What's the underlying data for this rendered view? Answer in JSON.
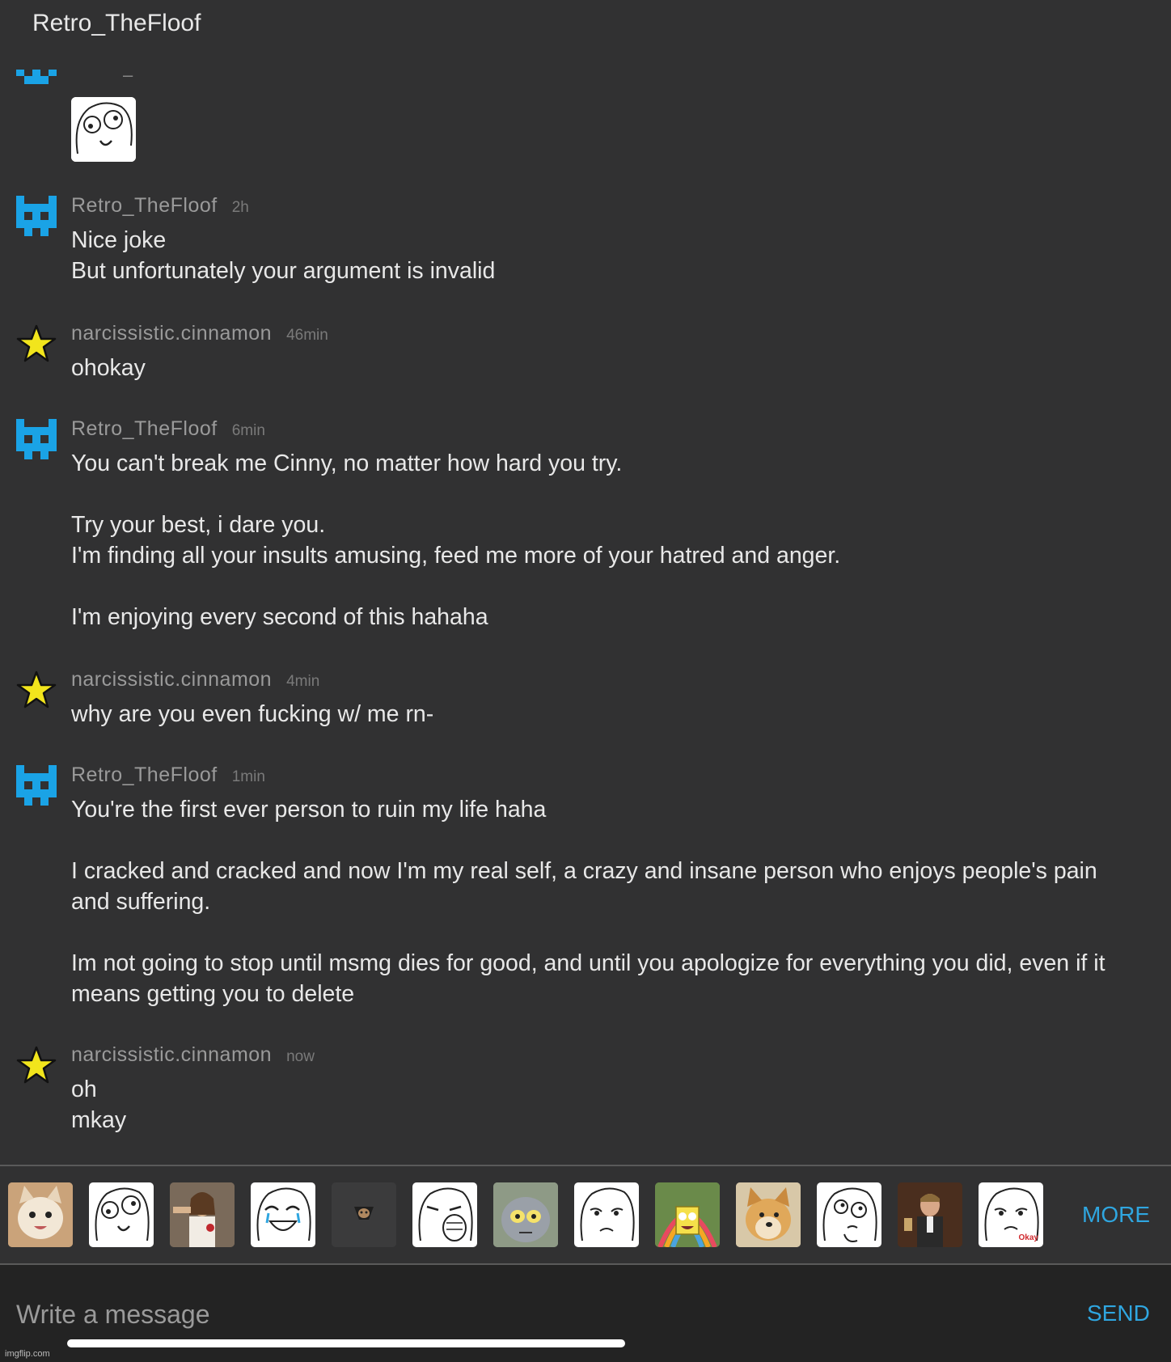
{
  "header": {
    "title": "Retro_TheFloof"
  },
  "top_partial": {
    "dash": "–"
  },
  "messages": [
    {
      "user": "Retro_TheFloof",
      "time": "2h",
      "avatar": "pixel-cat-icon",
      "lines": [
        "Nice joke",
        "But unfortunately your argument is invalid"
      ]
    },
    {
      "user": "narcissistic.cinnamon",
      "time": "46min",
      "avatar": "star-icon",
      "lines": [
        "ohokay"
      ]
    },
    {
      "user": "Retro_TheFloof",
      "time": "6min",
      "avatar": "pixel-cat-icon",
      "lines": [
        "You can't break me Cinny, no matter how hard you try.",
        "",
        "Try your best, i dare you.",
        "I'm finding all your insults amusing, feed me more of your hatred and anger.",
        "",
        "I'm enjoying every second of this hahaha"
      ]
    },
    {
      "user": "narcissistic.cinnamon",
      "time": "4min",
      "avatar": "star-icon",
      "lines": [
        "why are you even fucking w/ me rn-"
      ]
    },
    {
      "user": "Retro_TheFloof",
      "time": "1min",
      "avatar": "pixel-cat-icon",
      "lines": [
        "You're the first ever person to ruin my life haha",
        "",
        "I cracked and cracked and now I'm my real self, a crazy and insane person who enjoys people's pain",
        "and suffering.",
        "",
        "Im not going to stop until msmg dies for good, and until you apologize for everything you did, even if it",
        "means getting you to delete"
      ]
    },
    {
      "user": "narcissistic.cinnamon",
      "time": "now",
      "avatar": "star-icon",
      "lines": [
        "oh",
        "mkay"
      ]
    }
  ],
  "stickers": [
    {
      "name": "happy-cat-sticker"
    },
    {
      "name": "derp-face-sticker"
    },
    {
      "name": "buddy-christ-sticker"
    },
    {
      "name": "happy-tears-face-sticker"
    },
    {
      "name": "ceiling-cat-sticker"
    },
    {
      "name": "lol-face-sticker"
    },
    {
      "name": "unsettled-tom-sticker"
    },
    {
      "name": "okay-face-sticker"
    },
    {
      "name": "spongebob-imagination-sticker"
    },
    {
      "name": "doge-sticker"
    },
    {
      "name": "thinking-face-sticker"
    },
    {
      "name": "laughing-leo-sticker"
    },
    {
      "name": "okay-guy-sticker",
      "caption": "Okay"
    }
  ],
  "sticker_bar": {
    "more_label": "MORE"
  },
  "compose": {
    "placeholder": "Write a message",
    "send_label": "SEND"
  },
  "watermark": "imgflip.com",
  "colors": {
    "background": "#313132",
    "accent": "#2fa6e0",
    "pixel_avatar": "#1aa3e6",
    "star": "#f2e51c"
  }
}
